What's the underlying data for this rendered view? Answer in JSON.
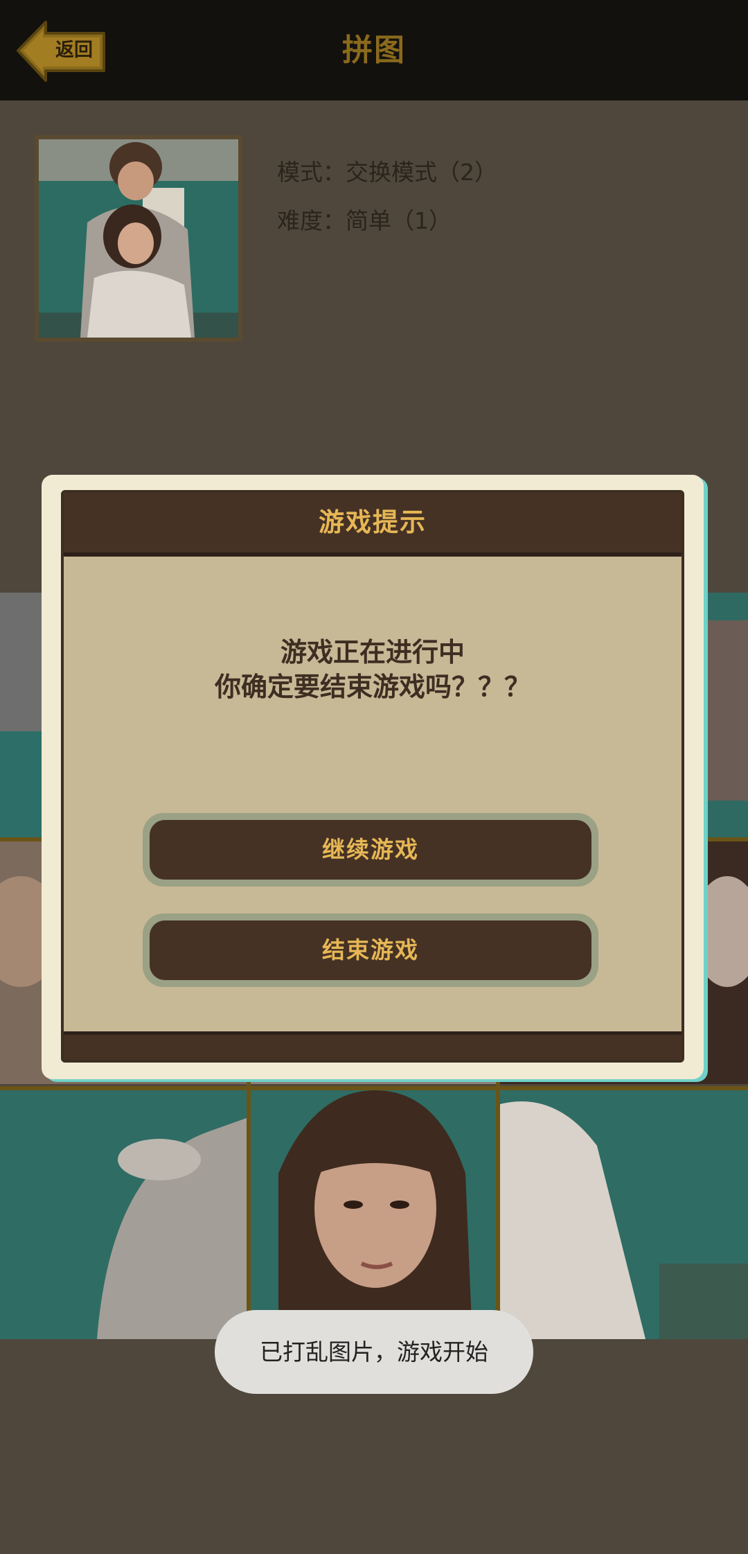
{
  "header": {
    "back_label": "返回",
    "title": "拼图"
  },
  "info": {
    "mode": "模式：交换模式（2）",
    "difficulty": "难度：简单（1）"
  },
  "modal": {
    "title": "游戏提示",
    "message_line1": "游戏正在进行中",
    "message_line2": "你确定要结束游戏吗？？？",
    "continue_label": "继续游戏",
    "end_label": "结束游戏"
  },
  "toast": {
    "text": "已打乱图片，游戏开始"
  },
  "colors": {
    "background": "#4f473c",
    "topbar": "#13110e",
    "title": "#8a6a1c",
    "modal_accent": "#e7b755",
    "modal_dark": "#453225",
    "modal_body": "#c7b896"
  }
}
